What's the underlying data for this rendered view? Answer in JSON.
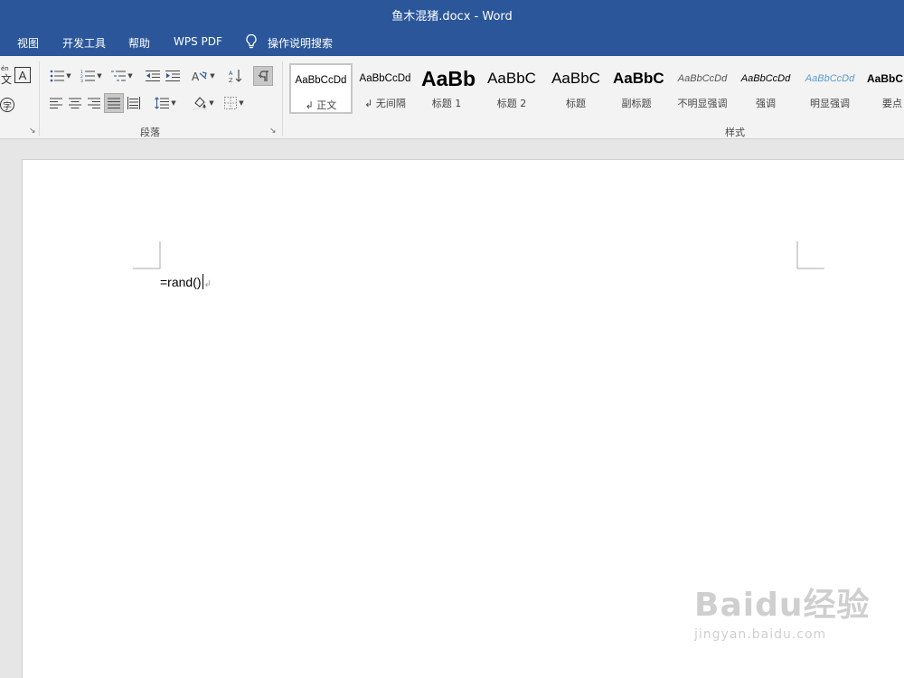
{
  "window": {
    "title": "鱼木混猪.docx  -  Word"
  },
  "tabs": [
    {
      "label": "视图"
    },
    {
      "label": "开发工具"
    },
    {
      "label": "帮助"
    },
    {
      "label": "WPS PDF"
    }
  ],
  "tell_me": {
    "label": "操作说明搜索"
  },
  "ribbon": {
    "paragraph_group": {
      "label": "段落"
    },
    "styles_group": {
      "label": "样式"
    },
    "partial_glyphs": {
      "pinyin": "én",
      "pinyin_char": "文",
      "char_border": "A",
      "enclosed": "字"
    }
  },
  "styles": [
    {
      "preview": "AaBbCcDd",
      "label": "↲ 正文",
      "selected": true
    },
    {
      "preview": "AaBbCcDd",
      "label": "↲ 无间隔"
    },
    {
      "preview": "AaBb",
      "label": "标题 1"
    },
    {
      "preview": "AaBbC",
      "label": "标题 2"
    },
    {
      "preview": "AaBbC",
      "label": "标题"
    },
    {
      "preview": "AaBbC",
      "label": "副标题"
    },
    {
      "preview": "AaBbCcDd",
      "label": "不明显强调"
    },
    {
      "preview": "AaBbCcDd",
      "label": "强调"
    },
    {
      "preview": "AaBbCcDd",
      "label": "明显强调"
    },
    {
      "preview": "AaBbC",
      "label": "要点"
    }
  ],
  "colors": {
    "accent": "#2b579a",
    "intense_emphasis": "#5b9bd5"
  },
  "document": {
    "text": "=rand()",
    "paragraph_mark": "↲"
  },
  "watermark": {
    "brand": "Baidu经验",
    "url": "jingyan.baidu.com"
  }
}
